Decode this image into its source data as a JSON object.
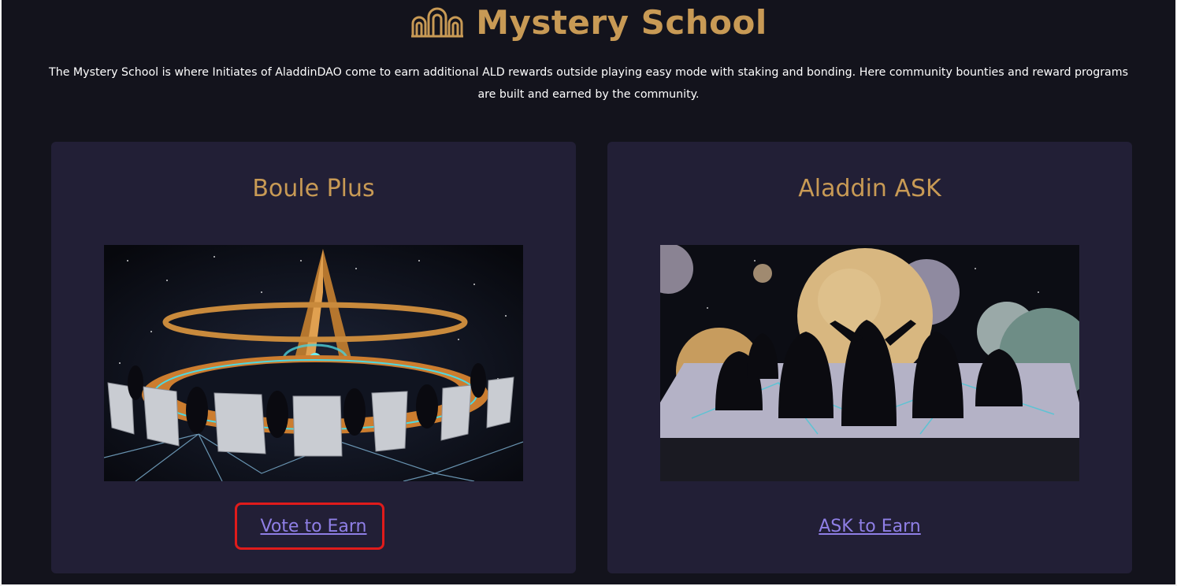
{
  "header": {
    "title": "Mystery School",
    "logo_icon": "temple-arches-icon",
    "accent_color": "#c89a55"
  },
  "intro": {
    "text": "The Mystery School is where Initiates of AladdinDAO come to earn additional ALD rewards outside playing easy mode with staking and bonding. Here community bounties and reward programs are built and earned by the community."
  },
  "cards": [
    {
      "title": "Boule Plus",
      "image": "boule-council-circle-illustration",
      "link_label": "Vote to Earn",
      "highlighted": true
    },
    {
      "title": "Aladdin ASK",
      "image": "aladdin-ask-planets-illustration",
      "link_label": "ASK to Earn",
      "highlighted": false
    }
  ],
  "colors": {
    "background": "#13131c",
    "card": "#221f36",
    "link": "#8f7fe6",
    "highlight": "#e01b1b"
  }
}
